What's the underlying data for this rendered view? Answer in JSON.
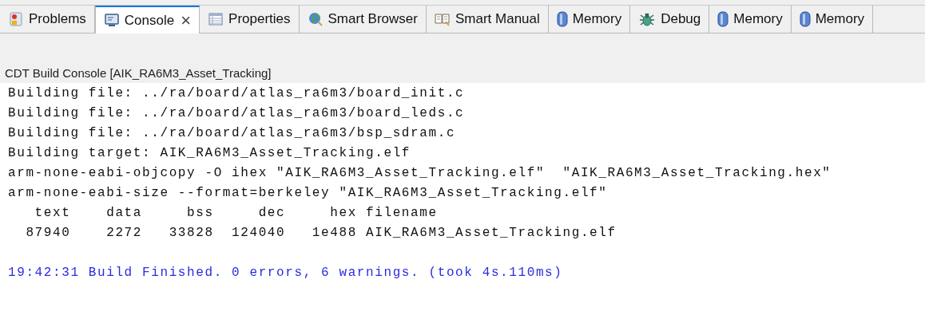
{
  "tabs": [
    {
      "label": "Problems",
      "kind": "problems",
      "selected": false
    },
    {
      "label": "Console",
      "kind": "console",
      "selected": true,
      "close": "×"
    },
    {
      "label": "Properties",
      "kind": "properties",
      "selected": false
    },
    {
      "label": "Smart Browser",
      "kind": "browser",
      "selected": false
    },
    {
      "label": "Smart Manual",
      "kind": "manual",
      "selected": false
    },
    {
      "label": "Memory",
      "kind": "memory",
      "selected": false
    },
    {
      "label": "Debug",
      "kind": "debug",
      "selected": false
    },
    {
      "label": "Memory",
      "kind": "memory",
      "selected": false
    },
    {
      "label": "Memory",
      "kind": "memory",
      "selected": false
    }
  ],
  "console": {
    "title": "CDT Build Console [AIK_RA6M3_Asset_Tracking]",
    "lines": [
      {
        "kind": "output",
        "text": "Building file: ../ra/board/atlas_ra6m3/board_init.c"
      },
      {
        "kind": "output",
        "text": "Building file: ../ra/board/atlas_ra6m3/board_leds.c"
      },
      {
        "kind": "output",
        "text": "Building file: ../ra/board/atlas_ra6m3/bsp_sdram.c"
      },
      {
        "kind": "output",
        "text": "Building target: AIK_RA6M3_Asset_Tracking.elf"
      },
      {
        "kind": "output",
        "text": "arm-none-eabi-objcopy -O ihex \"AIK_RA6M3_Asset_Tracking.elf\"  \"AIK_RA6M3_Asset_Tracking.hex\""
      },
      {
        "kind": "output",
        "text": "arm-none-eabi-size --format=berkeley \"AIK_RA6M3_Asset_Tracking.elf\""
      },
      {
        "kind": "output",
        "text": "   text    data     bss     dec     hex filename"
      },
      {
        "kind": "output",
        "text": "  87940    2272   33828  124040   1e488 AIK_RA6M3_Asset_Tracking.elf"
      },
      {
        "kind": "info",
        "text": "19:42:31 Build Finished. 0 errors, 6 warnings. (took 4s.110ms)"
      }
    ]
  }
}
